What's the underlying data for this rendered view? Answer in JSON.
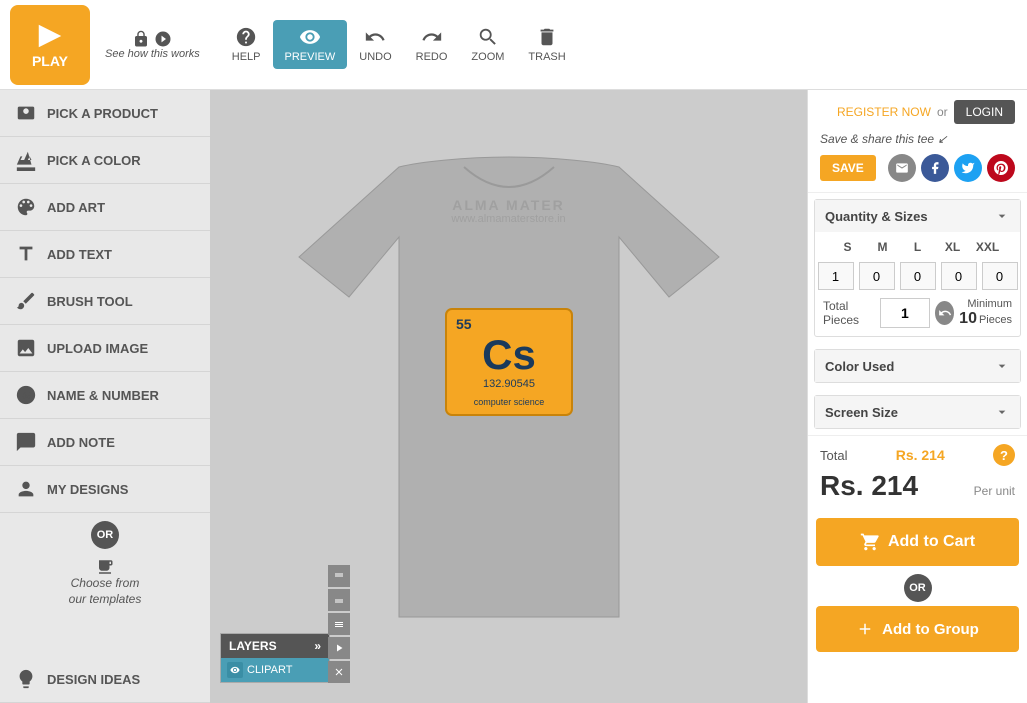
{
  "topbar": {
    "play_label": "PLAY",
    "how_it_works": "See how this works",
    "help_label": "HELP",
    "preview_label": "PREVIEW",
    "undo_label": "UNDO",
    "redo_label": "REDO",
    "zoom_label": "ZOOM",
    "trash_label": "TRASH"
  },
  "sidebar": {
    "items": [
      {
        "id": "pick-product",
        "label": "PICK A PRODUCT"
      },
      {
        "id": "pick-color",
        "label": "PICK A COLOR"
      },
      {
        "id": "add-art",
        "label": "ADD ART"
      },
      {
        "id": "add-text",
        "label": "ADD TEXT"
      },
      {
        "id": "brush-tool",
        "label": "BRUSH TOOL"
      },
      {
        "id": "upload-image",
        "label": "UPLOAD IMAGE"
      },
      {
        "id": "name-number",
        "label": "NAME & NUMBER"
      },
      {
        "id": "add-note",
        "label": "ADD NOTE"
      },
      {
        "id": "my-designs",
        "label": "MY DESIGNS"
      }
    ],
    "or_label": "OR",
    "choose_templates_line1": "Choose from",
    "choose_templates_line2": "our templates",
    "design_ideas_label": "DESIGN IDEAS"
  },
  "layers": {
    "header": "LAYERS",
    "expand_icon": "»",
    "rows": [
      {
        "label": "CLIPART"
      }
    ]
  },
  "watermark": {
    "line1": "ALMA MATER",
    "line2": "www.almamaterstore.in"
  },
  "right_panel": {
    "register_label": "REGISTER NOW",
    "or_label": "or",
    "login_label": "LOGIN",
    "save_share_text": "Save & share this tee",
    "save_label": "SAVE",
    "quantity_sizes_label": "Quantity & Sizes",
    "sizes": [
      "S",
      "M",
      "L",
      "XL",
      "XXL"
    ],
    "size_values": [
      "1",
      "0",
      "0",
      "0",
      "0"
    ],
    "total_pieces_label": "Total Pieces",
    "total_value": "1",
    "minimum_label": "Minimum",
    "minimum_value": "10",
    "pieces_label": "Pieces",
    "color_used_label": "Color Used",
    "screen_size_label": "Screen Size",
    "total_label": "Total",
    "total_amount": "Rs. 214",
    "price_display": "Rs. 214",
    "per_unit_label": "Per unit",
    "add_to_cart_label": "Add to Cart",
    "or_badge_label": "OR",
    "add_to_group_label": "Add to Group"
  }
}
